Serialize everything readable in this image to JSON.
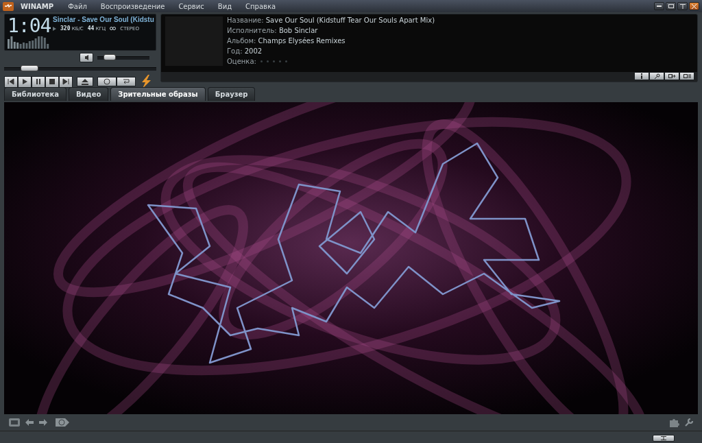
{
  "window": {
    "title": "WINAMP",
    "menu": [
      "Файл",
      "Воспроизведение",
      "Сервис",
      "Вид",
      "Справка"
    ]
  },
  "player": {
    "time": "1:04",
    "track_title": "Sinclar - Save Our Soul (Kidstu",
    "bitrate": "320",
    "bitrate_unit": "КБ/С",
    "samplerate": "44",
    "samplerate_unit": "КГЦ",
    "channels": "СТЕРЕО",
    "volume": {
      "level": 0.18
    },
    "seek": {
      "level": 0.12
    }
  },
  "info": {
    "fields": [
      {
        "label": "Название:",
        "value": "Save Our Soul (Kidstuff Tear Our Souls Apart Mix)"
      },
      {
        "label": "Исполнитель:",
        "value": "Bob Sinclar"
      },
      {
        "label": "Альбом:",
        "value": "Champs Elysées Remixes"
      },
      {
        "label": "Год:",
        "value": "2002"
      }
    ],
    "rating": {
      "label": "Оценка:",
      "stars": 0
    }
  },
  "tabs": [
    {
      "label": "Библиотека",
      "selected": false
    },
    {
      "label": "Видео",
      "selected": false
    },
    {
      "label": "Зрительные образы",
      "selected": true
    },
    {
      "label": "Браузер",
      "selected": false
    }
  ]
}
